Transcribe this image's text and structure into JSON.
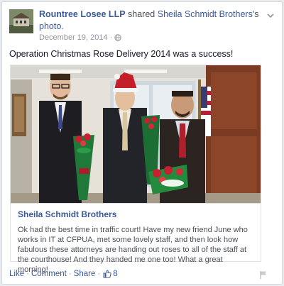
{
  "post": {
    "author": "Rountree Losee LLP",
    "action_text": "shared",
    "shared_from": "Sheila Schmidt Brothers",
    "possessive": "'s",
    "object_text": "photo.",
    "date": "December 19, 2014",
    "meta_sep": "·",
    "caption": "Operation Christmas Rose Delivery 2014 was a success!"
  },
  "shared": {
    "name": "Sheila Schmidt Brothers",
    "text": "Ok had the best time in traffic court! Have my new friend June who works in IT at CFPUA, met some lovely staff, and then look how fabulous these attorneys are handing out roses to all of the staff at the courthouse! And they handed me one too! What a great morning!"
  },
  "actions": {
    "like": "Like",
    "comment": "Comment",
    "share": "Share",
    "sep": "·",
    "like_count": "8"
  },
  "icons": {
    "options": "chevron-down-icon",
    "audience": "globe-icon",
    "likes": "thumbs-up-icon",
    "report": "flag-icon"
  },
  "colors": {
    "link": "#3b5998",
    "meta": "#90949c",
    "text": "#141823"
  }
}
